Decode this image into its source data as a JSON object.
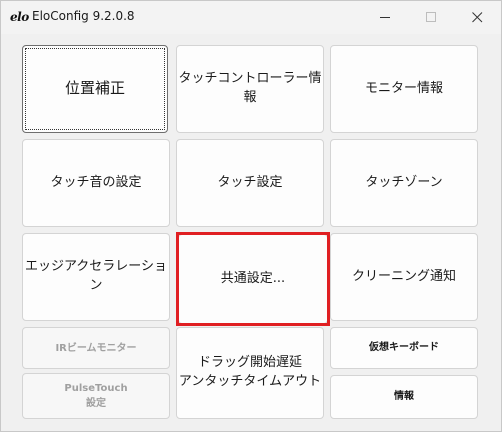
{
  "window": {
    "logo": "elo",
    "title": "EloConfig 9.2.0.8"
  },
  "buttons": {
    "position_correction": "位置補正",
    "touch_controller_info": "タッチコントローラー情報",
    "monitor_info": "モニター情報",
    "touch_sound_settings": "タッチ音の設定",
    "touch_settings": "タッチ設定",
    "touch_zone": "タッチゾーン",
    "edge_acceleration": "エッジアクセラレーション",
    "common_settings": "共通設定...",
    "cleaning_notification": "クリーニング通知",
    "ir_beam_monitor": "IRビームモニター",
    "pulsetouch_settings": "PulseTouch\n設定",
    "drag_delay_untouch_timeout": "ドラッグ開始遅延\nアンタッチタイムアウト",
    "virtual_keyboard": "仮想キーボード",
    "info": "情報"
  },
  "icons": {
    "minimize": "minimize-icon",
    "maximize": "maximize-icon",
    "close": "close-icon"
  },
  "colors": {
    "highlight": "#e01f22"
  }
}
